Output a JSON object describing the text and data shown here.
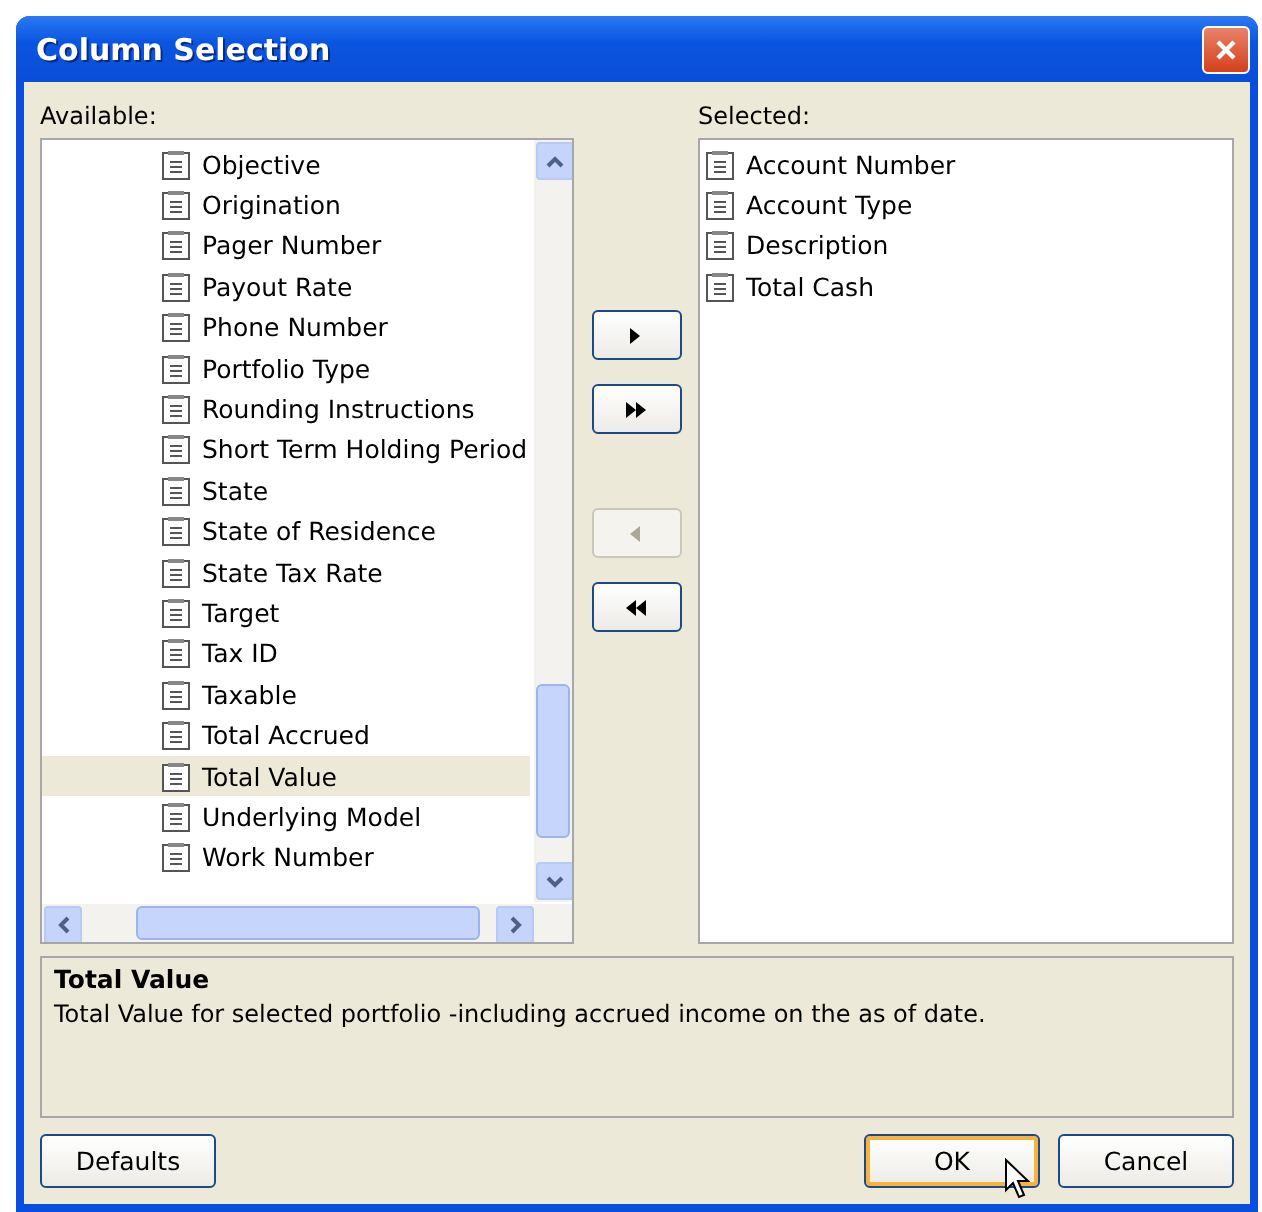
{
  "window": {
    "title": "Column Selection"
  },
  "available": {
    "label": "Available:",
    "items": [
      {
        "label": "Objective",
        "selected": false
      },
      {
        "label": "Origination",
        "selected": false
      },
      {
        "label": "Pager Number",
        "selected": false
      },
      {
        "label": "Payout Rate",
        "selected": false
      },
      {
        "label": "Phone Number",
        "selected": false
      },
      {
        "label": "Portfolio Type",
        "selected": false
      },
      {
        "label": "Rounding Instructions",
        "selected": false
      },
      {
        "label": "Short Term Holding Period",
        "selected": false
      },
      {
        "label": "State",
        "selected": false
      },
      {
        "label": "State of Residence",
        "selected": false
      },
      {
        "label": "State Tax Rate",
        "selected": false
      },
      {
        "label": "Target",
        "selected": false
      },
      {
        "label": "Tax ID",
        "selected": false
      },
      {
        "label": "Taxable",
        "selected": false
      },
      {
        "label": "Total Accrued",
        "selected": false
      },
      {
        "label": "Total Value",
        "selected": true
      },
      {
        "label": "Underlying Model",
        "selected": false
      },
      {
        "label": "Work Number",
        "selected": false
      }
    ]
  },
  "move_buttons": [
    {
      "kind": "add",
      "disabled": false
    },
    {
      "kind": "add_all",
      "disabled": false
    },
    {
      "kind": "remove",
      "disabled": true
    },
    {
      "kind": "remove_all",
      "disabled": false
    }
  ],
  "selected": {
    "label": "Selected:",
    "items": [
      {
        "label": "Account Number"
      },
      {
        "label": "Account Type"
      },
      {
        "label": "Description"
      },
      {
        "label": "Total Cash"
      }
    ]
  },
  "description": {
    "title": "Total Value",
    "text": "Total Value for selected portfolio -including accrued income on the as of date."
  },
  "buttons": [
    {
      "label": "Defaults",
      "kind": "left",
      "focused": false
    },
    {
      "label": "OK",
      "kind": "right",
      "focused": true
    },
    {
      "label": "Cancel",
      "kind": "right",
      "focused": false
    }
  ]
}
